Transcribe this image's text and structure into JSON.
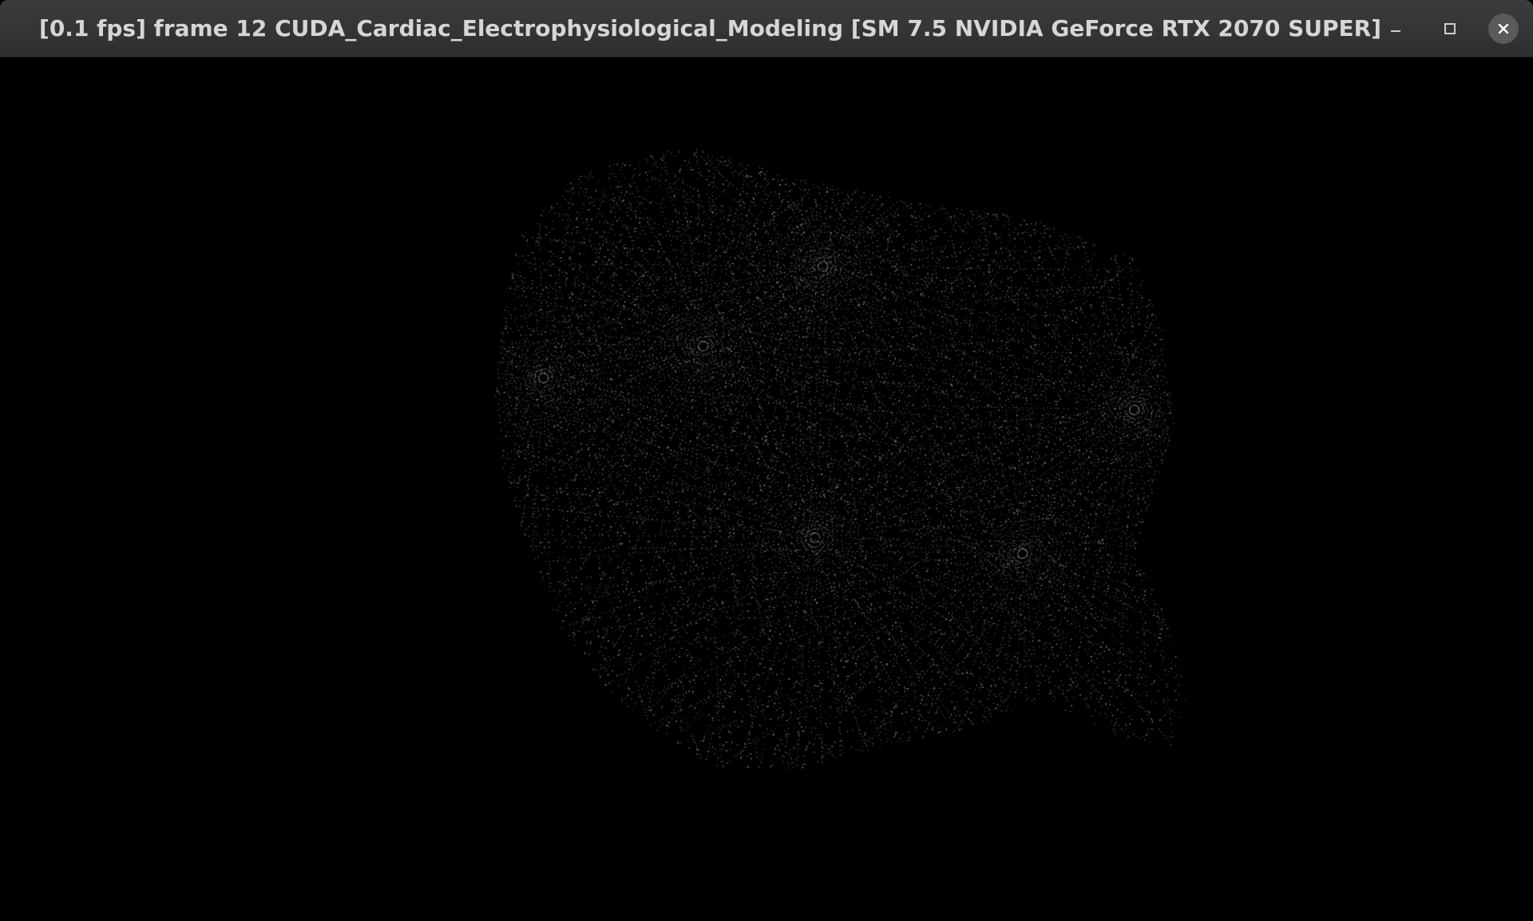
{
  "window": {
    "title": "[0.1 fps] frame 12 CUDA_Cardiac_Electrophysiological_Modeling [SM 7.5 NVIDIA GeForce RTX 2070 SUPER]",
    "controls": {
      "minimize_icon": "minimize-icon",
      "maximize_icon": "maximize-icon",
      "close_icon": "close-icon"
    }
  },
  "viewport": {
    "background_color": "#000000",
    "point_color": "#8a8a8a",
    "description_icon": "point-cloud-heart-mesh"
  }
}
